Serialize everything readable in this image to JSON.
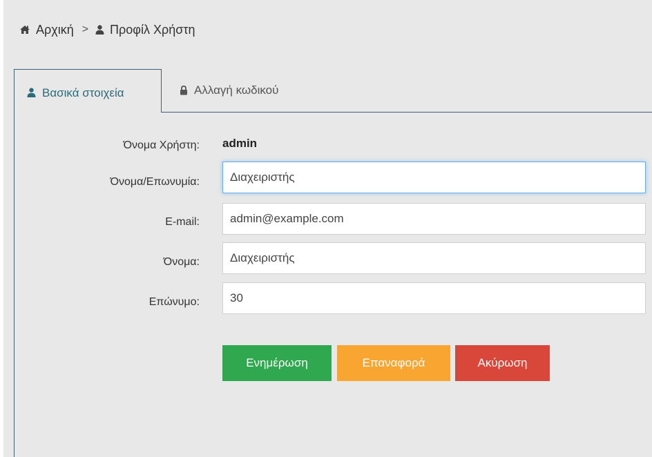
{
  "breadcrumb": {
    "home_label": "Αρχική",
    "separator": ">",
    "current_label": "Προφίλ Χρήστη"
  },
  "tabs": [
    {
      "label": "Βασικά στοιχεία",
      "icon": "user-icon",
      "active": true
    },
    {
      "label": "Αλλαγή κωδικού",
      "icon": "lock-icon",
      "active": false
    }
  ],
  "form": {
    "username": {
      "label": "Όνομα Χρήστη:",
      "value": "admin"
    },
    "fullname": {
      "label": "Όνομα/Επωνυμία:",
      "value": "Διαχειριστής"
    },
    "email": {
      "label": "E-mail:",
      "value": "admin@example.com"
    },
    "firstname": {
      "label": "Όνομα:",
      "value": "Διαχειριστής"
    },
    "lastname": {
      "label": "Επώνυμο:",
      "value": "30"
    }
  },
  "buttons": {
    "update": "Ενημέρωση",
    "reset": "Επαναφορά",
    "cancel": "Ακύρωση"
  },
  "colors": {
    "background": "#e8e8e8",
    "tab_active_text": "#2b6b7a",
    "tab_border": "#3c6077",
    "update": "#2fa84f",
    "reset": "#f8a531",
    "cancel": "#d9473a",
    "focus_border": "#66afe9"
  }
}
